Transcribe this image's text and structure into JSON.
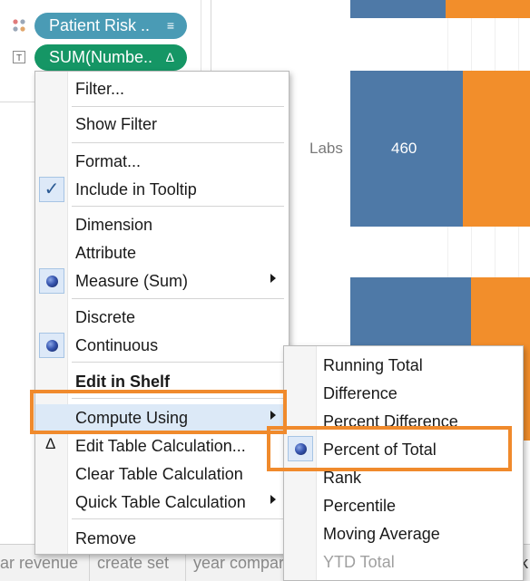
{
  "marks": [
    {
      "label": "Patient Risk ..",
      "type": "dimension",
      "icon": "detail-icon",
      "pill_icon": "sort-icon",
      "pill_symbol": "≡"
    },
    {
      "label": "SUM(Numbe..",
      "type": "measure",
      "icon": "text-icon",
      "icon_symbol": "T",
      "pill_icon": "table-calc-delta-icon",
      "pill_symbol": "Δ"
    }
  ],
  "chart": {
    "colors": {
      "series_a": "#4e79a7",
      "series_b": "#f28e2b"
    },
    "category_label": "Labs",
    "value_label": "460"
  },
  "context_menu": {
    "filter": "Filter...",
    "show_filter": "Show Filter",
    "format": "Format...",
    "include_in_tooltip": "Include in Tooltip",
    "tooltip_checked": true,
    "check_symbol": "✓",
    "dimension": "Dimension",
    "attribute": "Attribute",
    "measure_sum": "Measure (Sum)",
    "discrete": "Discrete",
    "continuous": "Continuous",
    "edit_in_shelf": "Edit in Shelf",
    "compute_using": "Compute Using",
    "edit_table_calc": "Edit Table Calculation...",
    "delta_symbol": "Δ",
    "clear_table_calc": "Clear Table Calculation",
    "quick_table_calc": "Quick Table Calculation",
    "remove": "Remove"
  },
  "submenu": {
    "items": [
      "Running Total",
      "Difference",
      "Percent Difference",
      "Percent of Total",
      "Rank",
      "Percentile",
      "Moving Average",
      "YTD Total"
    ],
    "selected": "Percent of Total",
    "disabled": [
      "YTD Total"
    ]
  },
  "tabs": [
    "ar revenue",
    "create set",
    "year compar"
  ],
  "tab_edge_fragment": "k",
  "annotation_color": "#f08a2c"
}
